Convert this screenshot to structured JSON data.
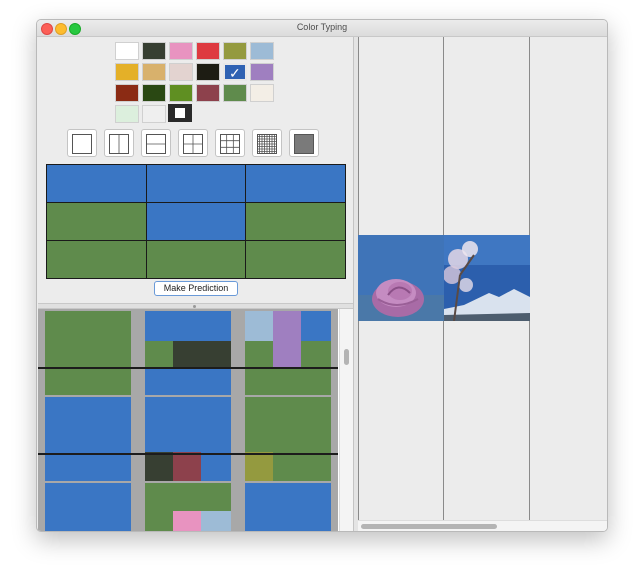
{
  "window": {
    "title": "Color Typing"
  },
  "palette": {
    "colors": [
      "#ffffff",
      "#373f32",
      "#e893c0",
      "#de3a40",
      "#949a3f",
      "#9dbbd6",
      "#e4b028",
      "#d8b16c",
      "#e3d3d0",
      "#1d1c13",
      "#2f62b3",
      "#9f7fc0",
      "#8b2b14",
      "#2a4813",
      "#5f8f22",
      "#8d414c",
      "#5f8b4c",
      "#f3eee6",
      "#dcefdd",
      "#efefef"
    ],
    "selected_index": 10,
    "selected_mark": "✓",
    "extra_swatch": "black-white-swatch"
  },
  "grid_buttons": [
    {
      "name": "grid-1x1",
      "rows": 1,
      "cols": 1
    },
    {
      "name": "grid-1x2",
      "rows": 1,
      "cols": 2
    },
    {
      "name": "grid-2x1",
      "rows": 2,
      "cols": 1
    },
    {
      "name": "grid-2x2",
      "rows": 2,
      "cols": 2
    },
    {
      "name": "grid-3x3",
      "rows": 3,
      "cols": 3
    },
    {
      "name": "grid-fine",
      "rows": 8,
      "cols": 8
    },
    {
      "name": "grid-solid",
      "rows": 0,
      "cols": 0
    }
  ],
  "mosaic": {
    "rows": [
      [
        "#3a76c4",
        "#3a76c4",
        "#3a76c4"
      ],
      [
        "#5f8b4c",
        "#3a76c4",
        "#5f8b4c"
      ],
      [
        "#5f8b4c",
        "#5f8b4c",
        "#5f8b4c"
      ]
    ]
  },
  "predict_button": {
    "label": "Make Prediction"
  },
  "results_colors": {
    "green": "#5f8b4c",
    "blue": "#3a76c4",
    "dark": "#373f32",
    "maroon": "#8d414c",
    "olive": "#949a3f",
    "pink": "#e893c0",
    "lightblue": "#9dbbd6",
    "purple": "#9f7fc0"
  },
  "photos": [
    {
      "name": "pink-rose-photo",
      "sky": "#3f74b8"
    },
    {
      "name": "cherry-blossom-mountain-photo",
      "sky": "#2c5fad"
    }
  ]
}
